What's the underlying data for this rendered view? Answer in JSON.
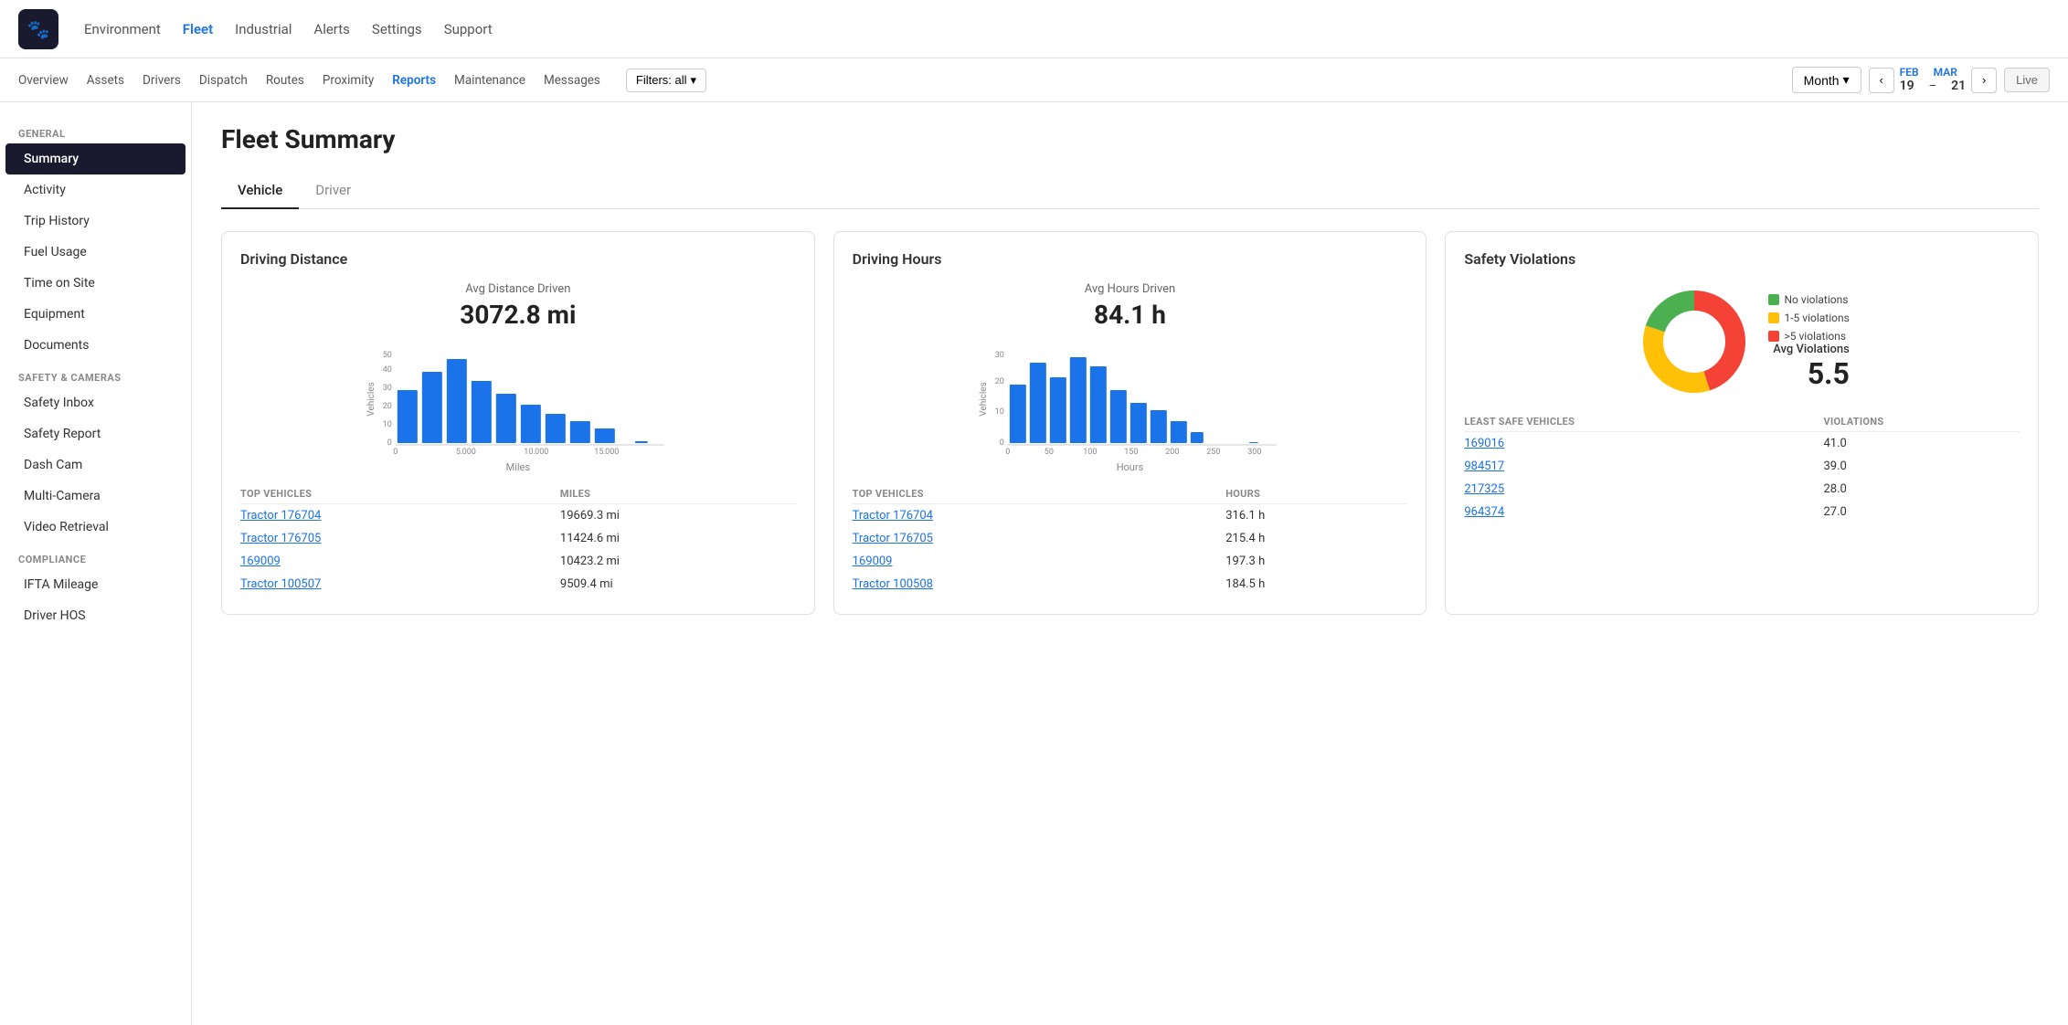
{
  "topNav": {
    "links": [
      {
        "label": "Environment",
        "active": false
      },
      {
        "label": "Fleet",
        "active": true
      },
      {
        "label": "Industrial",
        "active": false
      },
      {
        "label": "Alerts",
        "active": false
      },
      {
        "label": "Settings",
        "active": false
      },
      {
        "label": "Support",
        "active": false
      }
    ]
  },
  "subNav": {
    "links": [
      {
        "label": "Overview",
        "active": false
      },
      {
        "label": "Assets",
        "active": false
      },
      {
        "label": "Drivers",
        "active": false
      },
      {
        "label": "Dispatch",
        "active": false
      },
      {
        "label": "Routes",
        "active": false
      },
      {
        "label": "Proximity",
        "active": false
      },
      {
        "label": "Reports",
        "active": true
      },
      {
        "label": "Maintenance",
        "active": false
      },
      {
        "label": "Messages",
        "active": false
      }
    ],
    "filterLabel": "Filters: all",
    "monthLabel": "Month",
    "dateFrom": {
      "month": "FEB",
      "day": "19"
    },
    "dateDash": "–",
    "dateTo": {
      "month": "MAR",
      "day": "21"
    },
    "liveLabel": "Live"
  },
  "sidebar": {
    "sections": [
      {
        "label": "GENERAL",
        "items": [
          {
            "label": "Summary",
            "active": true
          },
          {
            "label": "Activity",
            "active": false
          },
          {
            "label": "Trip History",
            "active": false
          },
          {
            "label": "Fuel Usage",
            "active": false
          },
          {
            "label": "Time on Site",
            "active": false
          },
          {
            "label": "Equipment",
            "active": false
          },
          {
            "label": "Documents",
            "active": false
          }
        ]
      },
      {
        "label": "SAFETY & CAMERAS",
        "items": [
          {
            "label": "Safety Inbox",
            "active": false
          },
          {
            "label": "Safety Report",
            "active": false
          },
          {
            "label": "Dash Cam",
            "active": false
          },
          {
            "label": "Multi-Camera",
            "active": false
          },
          {
            "label": "Video Retrieval",
            "active": false
          }
        ]
      },
      {
        "label": "COMPLIANCE",
        "items": [
          {
            "label": "IFTA Mileage",
            "active": false
          },
          {
            "label": "Driver HOS",
            "active": false
          }
        ]
      }
    ]
  },
  "pageTitle": "Fleet Summary",
  "tabs": [
    {
      "label": "Vehicle",
      "active": true
    },
    {
      "label": "Driver",
      "active": false
    }
  ],
  "drivingDistance": {
    "title": "Driving Distance",
    "metricLabel": "Avg Distance Driven",
    "metricValue": "3072.8 mi",
    "yAxisLabel": "Vehicles",
    "xAxisLabel": "Miles",
    "xAxisTicks": [
      "0",
      "5,000",
      "10,000",
      "15,000"
    ],
    "yAxisTicks": [
      "0",
      "10",
      "20",
      "30",
      "40",
      "50"
    ],
    "tableHeaders": [
      "TOP VEHICLES",
      "MILES"
    ],
    "tableRows": [
      {
        "vehicle": "Tractor 176704",
        "value": "19669.3 mi"
      },
      {
        "vehicle": "Tractor 176705",
        "value": "11424.6 mi"
      },
      {
        "vehicle": "169009",
        "value": "10423.2 mi"
      },
      {
        "vehicle": "Tractor 100507",
        "value": "9509.4 mi"
      }
    ]
  },
  "drivingHours": {
    "title": "Driving Hours",
    "metricLabel": "Avg Hours Driven",
    "metricValue": "84.1 h",
    "yAxisLabel": "Vehicles",
    "xAxisLabel": "Hours",
    "xAxisTicks": [
      "0",
      "50",
      "100",
      "150",
      "200",
      "250",
      "300"
    ],
    "yAxisTicks": [
      "0",
      "10",
      "20",
      "30"
    ],
    "tableHeaders": [
      "TOP VEHICLES",
      "HOURS"
    ],
    "tableRows": [
      {
        "vehicle": "Tractor 176704",
        "value": "316.1 h"
      },
      {
        "vehicle": "Tractor 176705",
        "value": "215.4 h"
      },
      {
        "vehicle": "169009",
        "value": "197.3 h"
      },
      {
        "vehicle": "Tractor 100508",
        "value": "184.5 h"
      }
    ]
  },
  "safetyViolations": {
    "title": "Safety Violations",
    "avgViolationsLabel": "Avg Violations",
    "avgViolationsValue": "5.5",
    "legend": [
      {
        "label": "No violations",
        "color": "#4caf50"
      },
      {
        "label": "1-5 violations",
        "color": "#ffc107"
      },
      {
        "label": ">5 violations",
        "color": "#f44336"
      }
    ],
    "donutSegments": [
      {
        "label": "No violations",
        "color": "#4caf50",
        "percent": 20
      },
      {
        "label": "1-5 violations",
        "color": "#ffc107",
        "percent": 35
      },
      {
        "label": ">5 violations",
        "color": "#f44336",
        "percent": 45
      }
    ],
    "tableHeaders": [
      "LEAST SAFE VEHICLES",
      "VIOLATIONS"
    ],
    "tableRows": [
      {
        "vehicle": "169016",
        "value": "41.0"
      },
      {
        "vehicle": "984517",
        "value": "39.0"
      },
      {
        "vehicle": "217325",
        "value": "28.0"
      },
      {
        "vehicle": "964374",
        "value": "27.0"
      }
    ]
  }
}
